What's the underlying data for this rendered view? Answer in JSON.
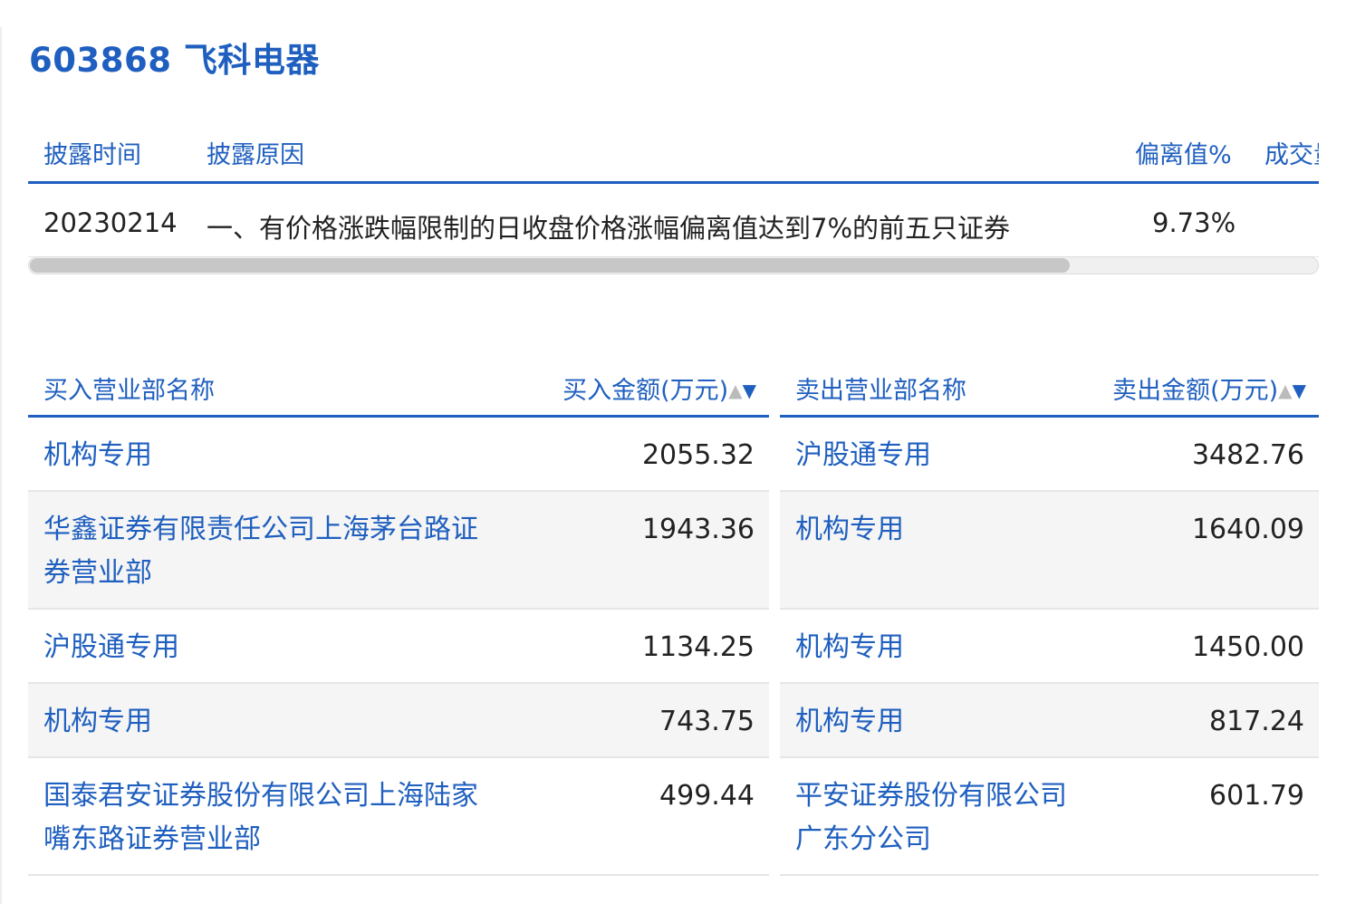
{
  "stock": {
    "title": "603868 飞科电器"
  },
  "disclosure": {
    "headers": {
      "time": "披露时间",
      "reason": "披露原因",
      "deviation": "偏离值%",
      "volume": "成交量"
    },
    "rows": [
      {
        "time": "20230214",
        "reason": "一、有价格涨跌幅限制的日收盘价格涨幅偏离值达到7%的前五只证券",
        "deviation": "9.73%"
      }
    ]
  },
  "buy": {
    "headers": {
      "name": "买入营业部名称",
      "amount": "买入金额(万元)"
    },
    "rows": [
      {
        "name": "机构专用",
        "amount": "2055.32"
      },
      {
        "name": "华鑫证券有限责任公司上海茅台路证券营业部",
        "amount": "1943.36"
      },
      {
        "name": "沪股通专用",
        "amount": "1134.25"
      },
      {
        "name": "机构专用",
        "amount": "743.75"
      },
      {
        "name": "国泰君安证券股份有限公司上海陆家嘴东路证券营业部",
        "amount": "499.44"
      }
    ]
  },
  "sell": {
    "headers": {
      "name": "卖出营业部名称",
      "amount": "卖出金额(万元)"
    },
    "rows": [
      {
        "name": "沪股通专用",
        "amount": "3482.76"
      },
      {
        "name": "机构专用",
        "amount": "1640.09"
      },
      {
        "name": "机构专用",
        "amount": "1450.00"
      },
      {
        "name": "机构专用",
        "amount": "817.24"
      },
      {
        "name": "平安证券股份有限公司广东分公司",
        "amount": "601.79"
      }
    ]
  },
  "sort_icons": {
    "up": "▲",
    "down": "▼"
  },
  "colors": {
    "accent": "#1f5fbf",
    "text": "#222222",
    "row_alt": "#f5f5f5"
  }
}
